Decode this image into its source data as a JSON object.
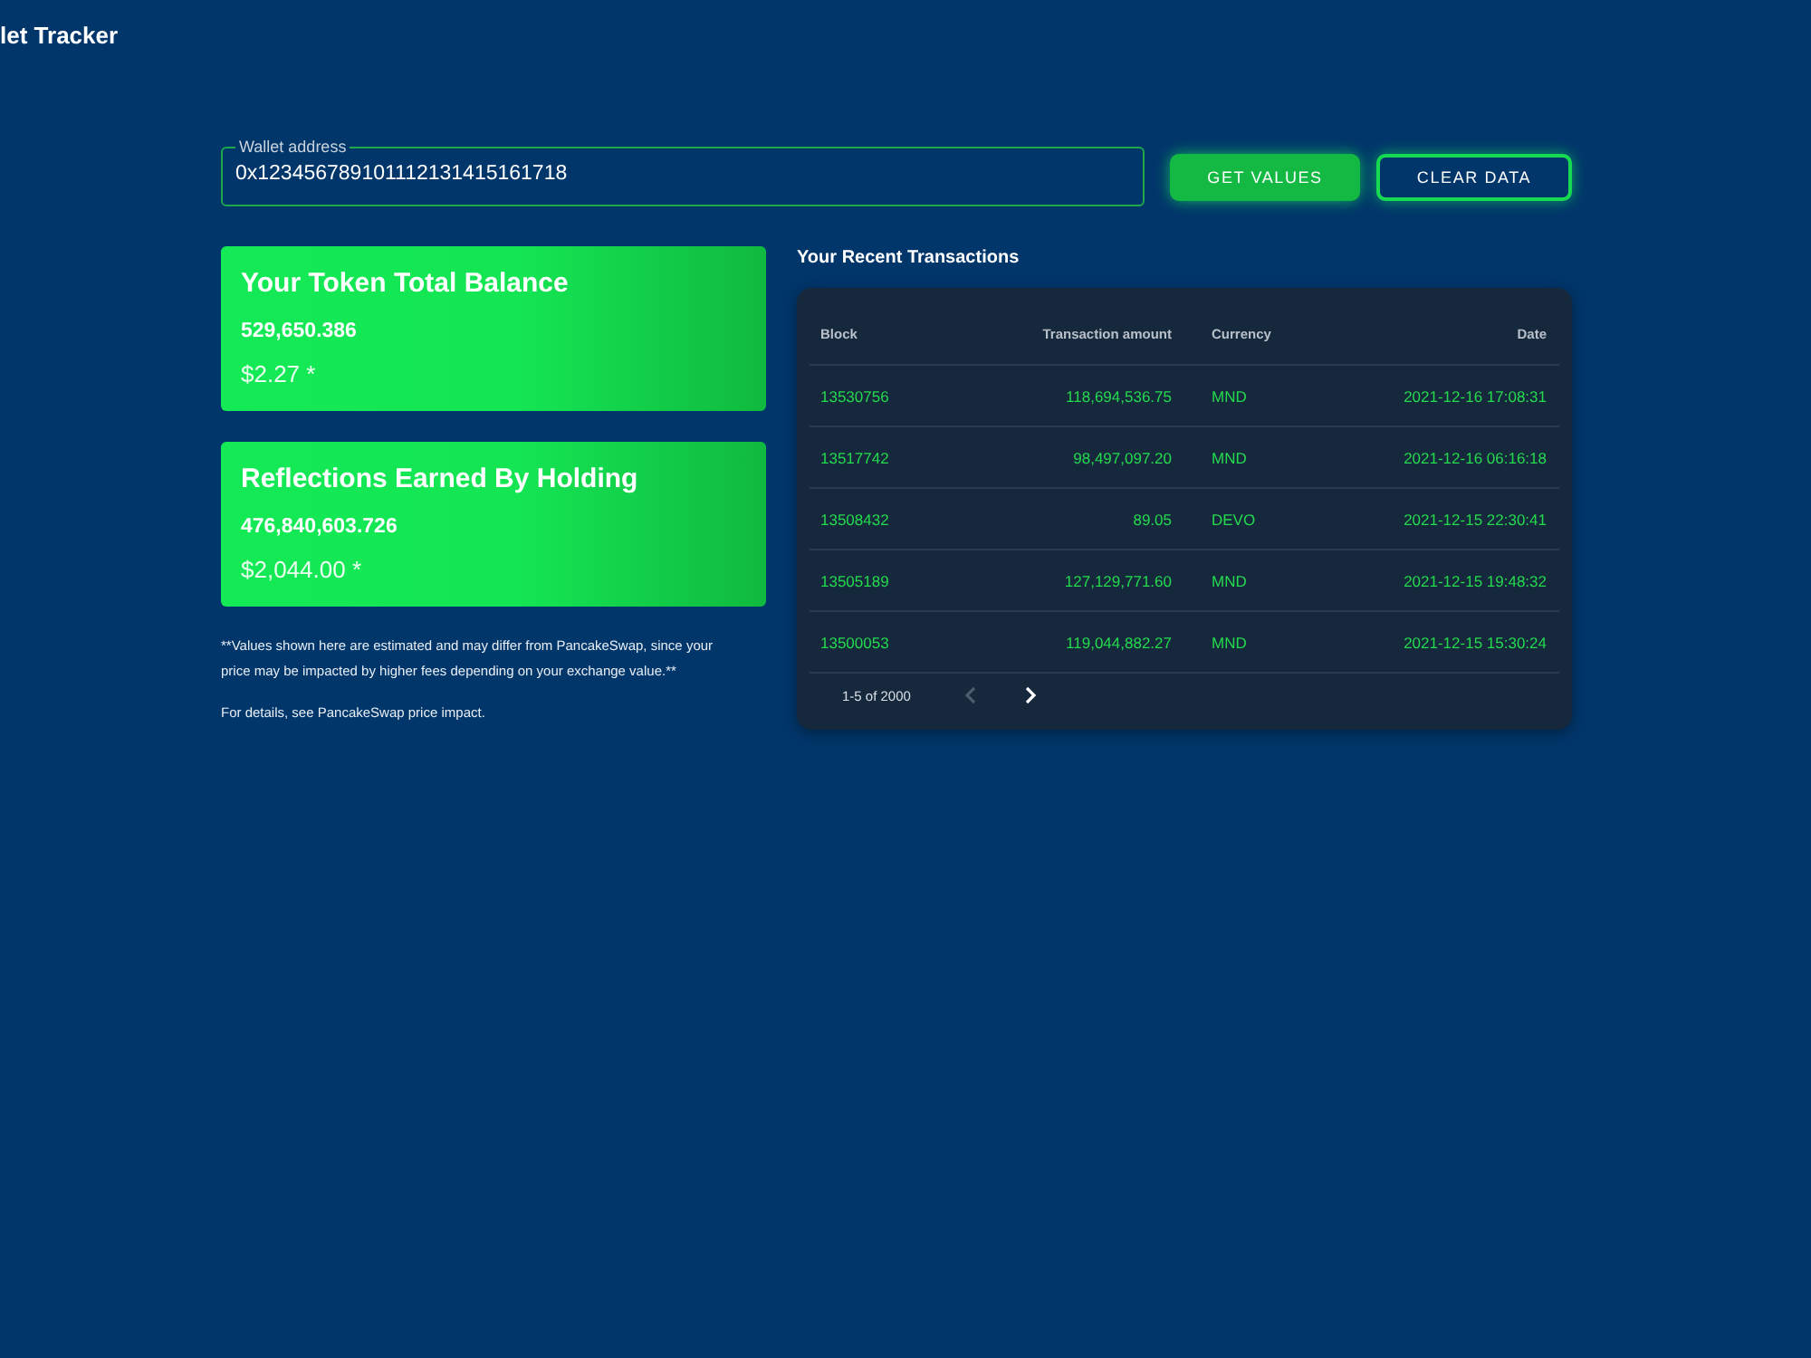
{
  "header": {
    "title": "let Tracker"
  },
  "wallet": {
    "label": "Wallet address",
    "value": "0x123456789101112131415161718"
  },
  "buttons": [
    {
      "label": "GET VALUES",
      "kind": "primary"
    },
    {
      "label": "CLEAR DATA",
      "kind": "outline"
    }
  ],
  "cards": [
    {
      "title": "Your Token Total Balance",
      "amount": "529,650.386",
      "value": "$2.27 *"
    },
    {
      "title": "Reflections Earned By Holding",
      "amount": "476,840,603.726",
      "value": "$2,044.00 *"
    }
  ],
  "disclaimer": [
    "**Values shown here are estimated and may differ from PancakeSwap, since your price may be impacted by higher fees depending on your exchange value.**",
    "For details, see PancakeSwap price impact."
  ],
  "transactions": {
    "title": "Your Recent Transactions",
    "columns": [
      "Block",
      "Transaction amount",
      "Currency",
      "Date"
    ],
    "rows": [
      [
        "13530756",
        "118,694,536.75",
        "MND",
        "2021-12-16 17:08:31"
      ],
      [
        "13517742",
        "98,497,097.20",
        "MND",
        "2021-12-16 06:16:18"
      ],
      [
        "13508432",
        "89.05",
        "DEVO",
        "2021-12-15 22:30:41"
      ],
      [
        "13505189",
        "127,129,771.60",
        "MND",
        "2021-12-15 19:48:32"
      ],
      [
        "13500053",
        "119,044,882.27",
        "MND",
        "2021-12-15 15:30:24"
      ]
    ],
    "pagination": {
      "range": "1-5 of 2000",
      "prev": {
        "disabled": true
      },
      "next": {
        "disabled": false
      }
    }
  }
}
